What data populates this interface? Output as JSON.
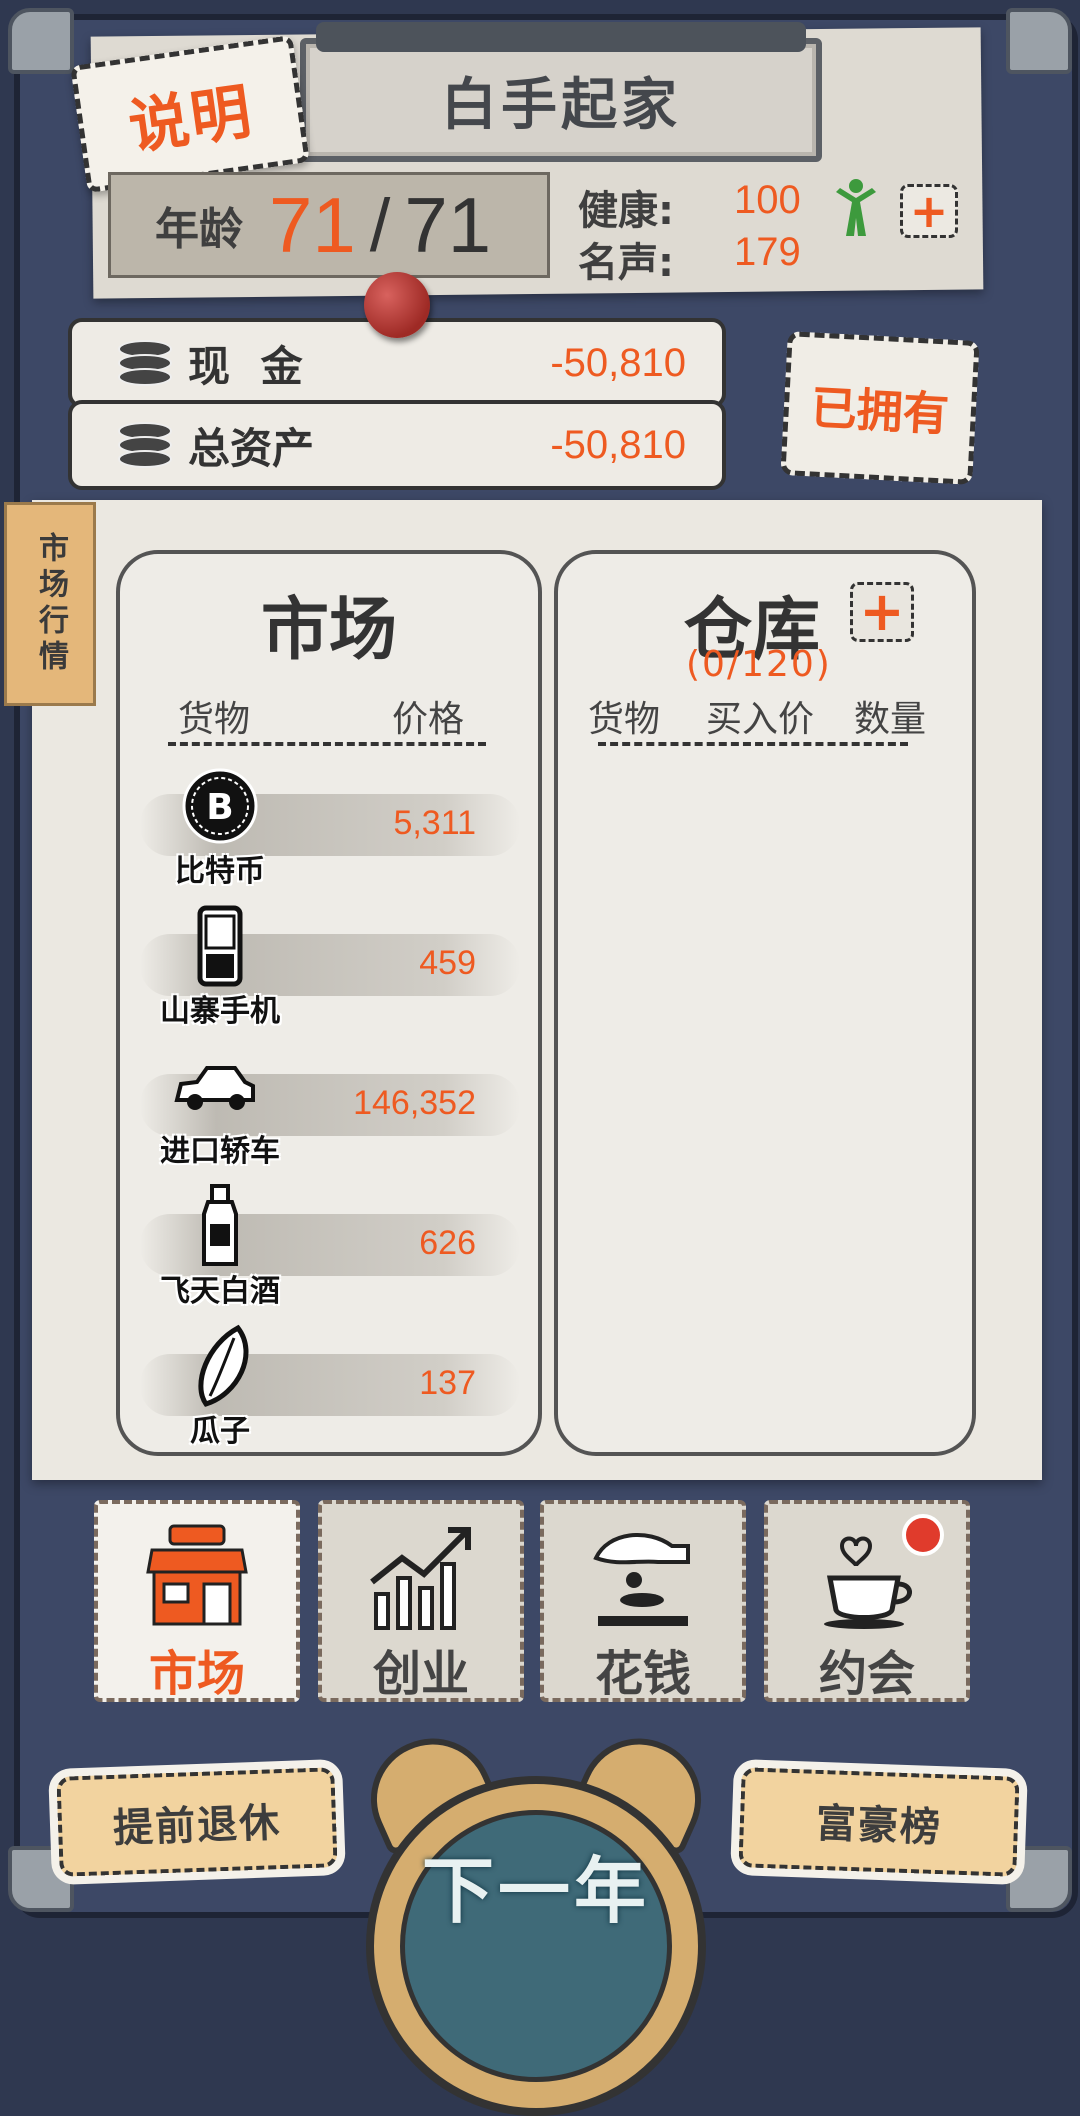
{
  "title": "白手起家",
  "explain_label": "说明",
  "age": {
    "label": "年龄",
    "current": "71",
    "separator": "/",
    "max": "71"
  },
  "stats": [
    {
      "label": "健康:",
      "value": "100"
    },
    {
      "label": "名声:",
      "value": "179"
    }
  ],
  "health_plus": "+",
  "money": {
    "cash_label": "现 金",
    "cash_value": "-50,810",
    "assets_label": "总资产",
    "assets_value": "-50,810"
  },
  "owned_label": "已拥有",
  "side_tag": "市场行情",
  "market": {
    "title": "市场",
    "col_goods": "货物",
    "col_price": "价格",
    "items": [
      {
        "name": "比特币",
        "price": "5,311",
        "icon": "bitcoin-icon"
      },
      {
        "name": "山寨手机",
        "price": "459",
        "icon": "phone-icon"
      },
      {
        "name": "进口轿车",
        "price": "146,352",
        "icon": "car-icon"
      },
      {
        "name": "飞天白酒",
        "price": "626",
        "icon": "liquor-bottle-icon"
      },
      {
        "name": "瓜子",
        "price": "137",
        "icon": "seed-icon"
      }
    ]
  },
  "warehouse": {
    "title": "仓库",
    "plus": "+",
    "capacity": "(0/120)",
    "col_goods": "货物",
    "col_buy_price": "买入价",
    "col_qty": "数量"
  },
  "tabs": [
    {
      "label": "市场",
      "icon": "shop-icon",
      "active": true
    },
    {
      "label": "创业",
      "icon": "growth-chart-icon",
      "active": false
    },
    {
      "label": "花钱",
      "icon": "spend-money-icon",
      "active": false
    },
    {
      "label": "约会",
      "icon": "coffee-date-icon",
      "active": false
    }
  ],
  "buttons": {
    "retire": "提前退休",
    "rich_list": "富豪榜",
    "next_year": "下一年"
  },
  "colors": {
    "accent": "#ee5a21",
    "frame": "#3d4866",
    "paper": "#ebe8e1",
    "clock": "#d5ad6f"
  }
}
